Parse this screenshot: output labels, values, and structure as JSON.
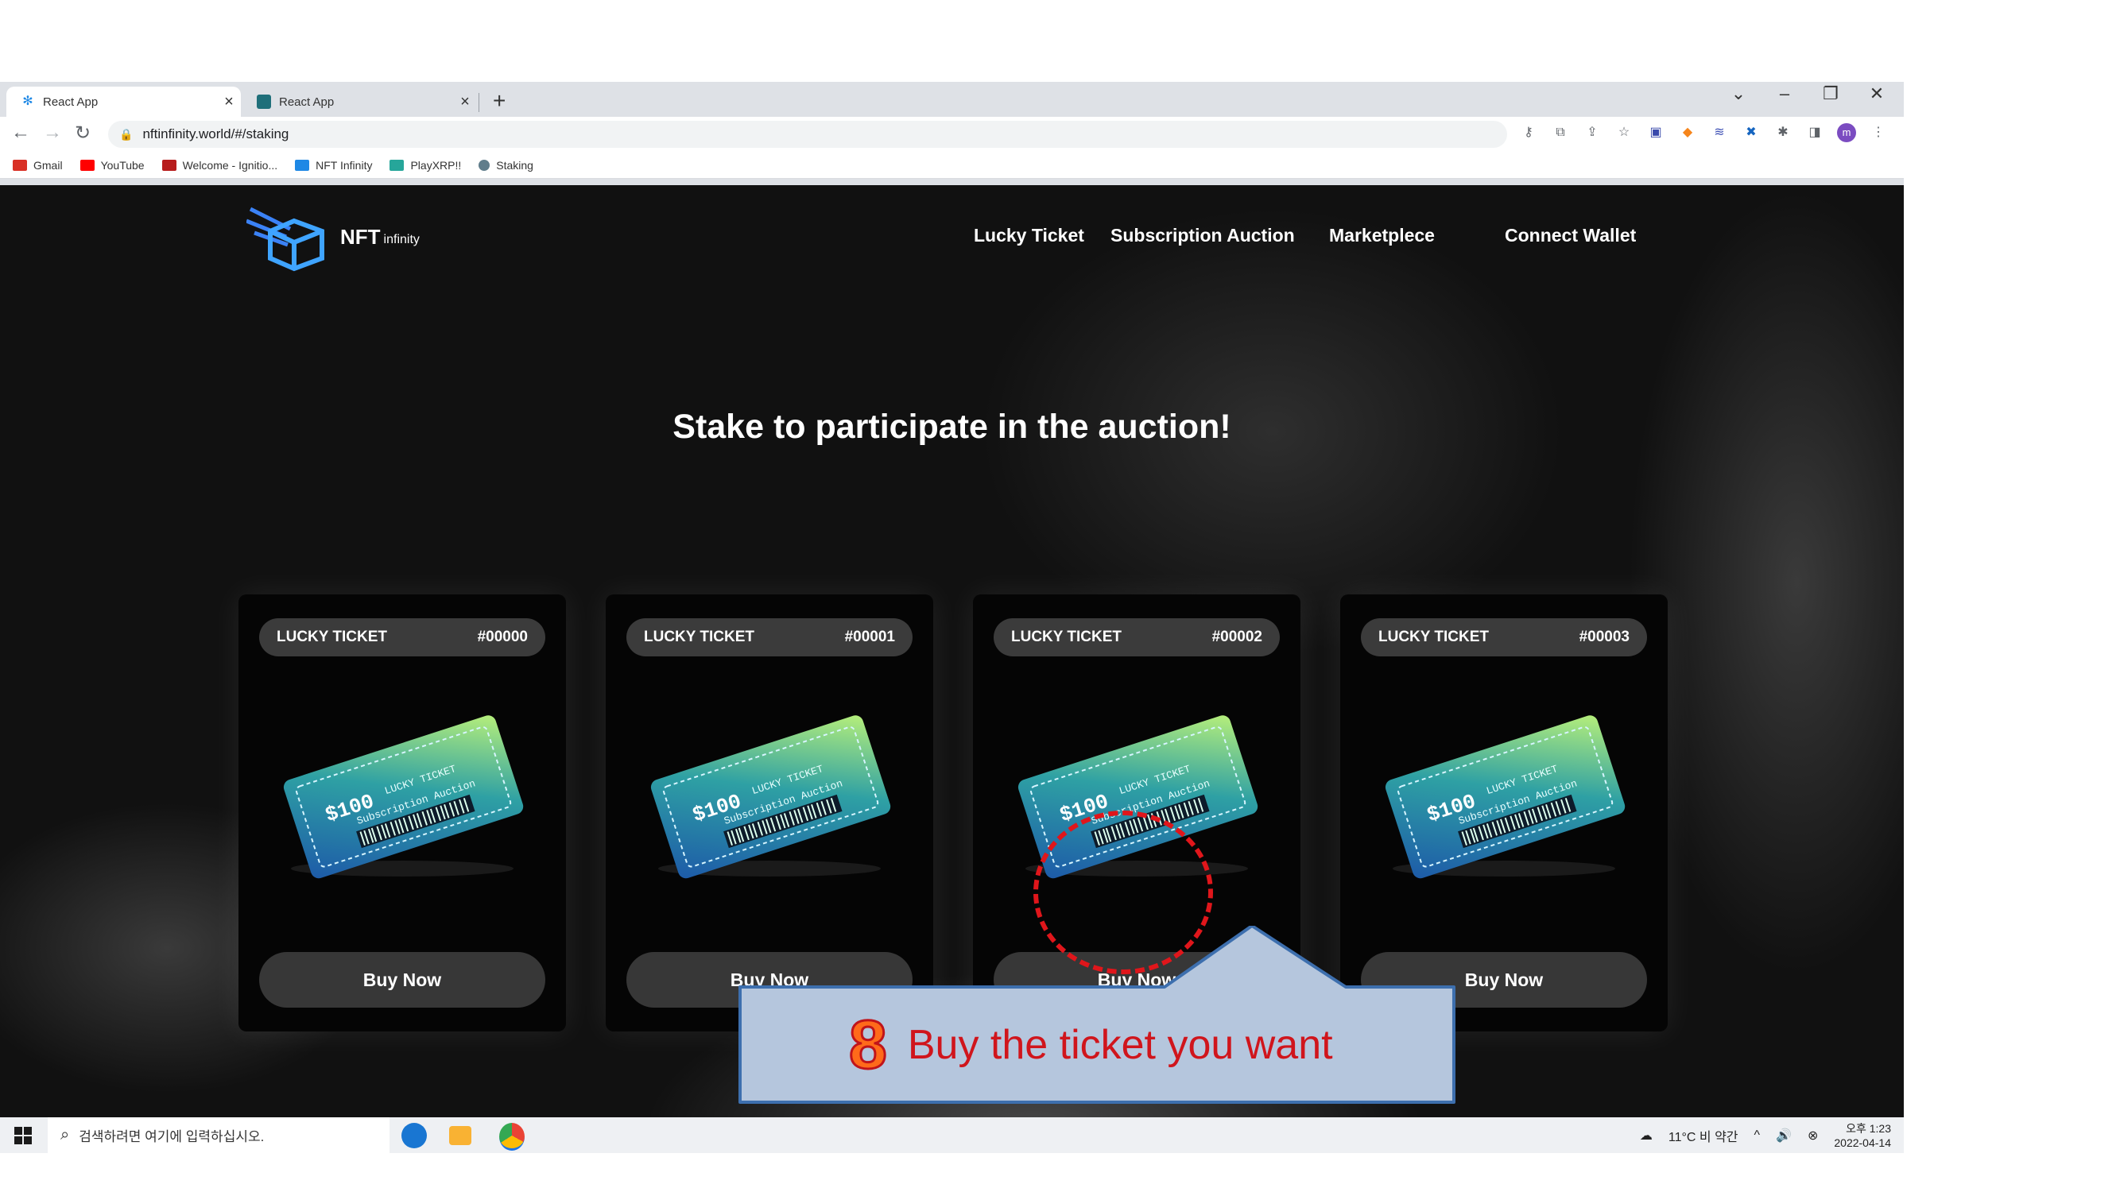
{
  "browser": {
    "tabs": [
      {
        "title": "React App",
        "active": true
      },
      {
        "title": "React App",
        "active": false
      }
    ],
    "new_tab": "+",
    "url": "nftinfinity.world/#/staking",
    "bookmarks": [
      {
        "label": "Gmail",
        "icon": "gmail-icon",
        "color": "#d93025"
      },
      {
        "label": "YouTube",
        "icon": "youtube-icon",
        "color": "#ff0000"
      },
      {
        "label": "Welcome - Ignitio...",
        "icon": "ignition-icon",
        "color": "#b71c1c"
      },
      {
        "label": "NFT Infinity",
        "icon": "nft-infinity-icon",
        "color": "#1e88e5"
      },
      {
        "label": "PlayXRP!!",
        "icon": "playxrp-icon",
        "color": "#26a69a"
      },
      {
        "label": "Staking",
        "icon": "staking-icon",
        "color": "#607d8b"
      }
    ]
  },
  "site": {
    "logo_main": "NFT",
    "logo_sub": "infinity",
    "nav": [
      "Lucky Ticket",
      "Subscription Auction",
      "Marketplece",
      "Connect Wallet"
    ],
    "headline": "Stake to participate in the auction!",
    "ticket_text": {
      "price": "$100",
      "title": "LUCKY TICKET",
      "subtitle": "Subscription Auction"
    },
    "cards": [
      {
        "label": "LUCKY TICKET",
        "number": "#00000",
        "button": "Buy Now"
      },
      {
        "label": "LUCKY TICKET",
        "number": "#00001",
        "button": "Buy Now"
      },
      {
        "label": "LUCKY TICKET",
        "number": "#00002",
        "button": "Buy Now"
      },
      {
        "label": "LUCKY TICKET",
        "number": "#00003",
        "button": "Buy Now"
      }
    ]
  },
  "annotation": {
    "step": "8",
    "text": "Buy the ticket you want",
    "color": "#e0161b"
  },
  "taskbar": {
    "search_placeholder": "검색하려면 여기에 입력하십시오.",
    "weather": "11°C 비 약간",
    "time": "오후 1:23",
    "date": "2022-04-14"
  }
}
